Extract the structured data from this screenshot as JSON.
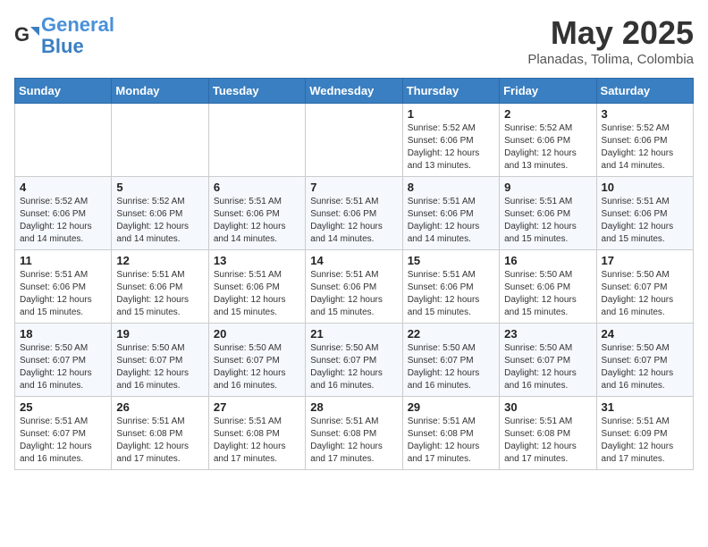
{
  "logo": {
    "line1": "General",
    "line2": "Blue"
  },
  "title": "May 2025",
  "location": "Planadas, Tolima, Colombia",
  "weekdays": [
    "Sunday",
    "Monday",
    "Tuesday",
    "Wednesday",
    "Thursday",
    "Friday",
    "Saturday"
  ],
  "weeks": [
    [
      {
        "day": "",
        "info": ""
      },
      {
        "day": "",
        "info": ""
      },
      {
        "day": "",
        "info": ""
      },
      {
        "day": "",
        "info": ""
      },
      {
        "day": "1",
        "info": "Sunrise: 5:52 AM\nSunset: 6:06 PM\nDaylight: 12 hours\nand 13 minutes."
      },
      {
        "day": "2",
        "info": "Sunrise: 5:52 AM\nSunset: 6:06 PM\nDaylight: 12 hours\nand 13 minutes."
      },
      {
        "day": "3",
        "info": "Sunrise: 5:52 AM\nSunset: 6:06 PM\nDaylight: 12 hours\nand 14 minutes."
      }
    ],
    [
      {
        "day": "4",
        "info": "Sunrise: 5:52 AM\nSunset: 6:06 PM\nDaylight: 12 hours\nand 14 minutes."
      },
      {
        "day": "5",
        "info": "Sunrise: 5:52 AM\nSunset: 6:06 PM\nDaylight: 12 hours\nand 14 minutes."
      },
      {
        "day": "6",
        "info": "Sunrise: 5:51 AM\nSunset: 6:06 PM\nDaylight: 12 hours\nand 14 minutes."
      },
      {
        "day": "7",
        "info": "Sunrise: 5:51 AM\nSunset: 6:06 PM\nDaylight: 12 hours\nand 14 minutes."
      },
      {
        "day": "8",
        "info": "Sunrise: 5:51 AM\nSunset: 6:06 PM\nDaylight: 12 hours\nand 14 minutes."
      },
      {
        "day": "9",
        "info": "Sunrise: 5:51 AM\nSunset: 6:06 PM\nDaylight: 12 hours\nand 15 minutes."
      },
      {
        "day": "10",
        "info": "Sunrise: 5:51 AM\nSunset: 6:06 PM\nDaylight: 12 hours\nand 15 minutes."
      }
    ],
    [
      {
        "day": "11",
        "info": "Sunrise: 5:51 AM\nSunset: 6:06 PM\nDaylight: 12 hours\nand 15 minutes."
      },
      {
        "day": "12",
        "info": "Sunrise: 5:51 AM\nSunset: 6:06 PM\nDaylight: 12 hours\nand 15 minutes."
      },
      {
        "day": "13",
        "info": "Sunrise: 5:51 AM\nSunset: 6:06 PM\nDaylight: 12 hours\nand 15 minutes."
      },
      {
        "day": "14",
        "info": "Sunrise: 5:51 AM\nSunset: 6:06 PM\nDaylight: 12 hours\nand 15 minutes."
      },
      {
        "day": "15",
        "info": "Sunrise: 5:51 AM\nSunset: 6:06 PM\nDaylight: 12 hours\nand 15 minutes."
      },
      {
        "day": "16",
        "info": "Sunrise: 5:50 AM\nSunset: 6:06 PM\nDaylight: 12 hours\nand 15 minutes."
      },
      {
        "day": "17",
        "info": "Sunrise: 5:50 AM\nSunset: 6:07 PM\nDaylight: 12 hours\nand 16 minutes."
      }
    ],
    [
      {
        "day": "18",
        "info": "Sunrise: 5:50 AM\nSunset: 6:07 PM\nDaylight: 12 hours\nand 16 minutes."
      },
      {
        "day": "19",
        "info": "Sunrise: 5:50 AM\nSunset: 6:07 PM\nDaylight: 12 hours\nand 16 minutes."
      },
      {
        "day": "20",
        "info": "Sunrise: 5:50 AM\nSunset: 6:07 PM\nDaylight: 12 hours\nand 16 minutes."
      },
      {
        "day": "21",
        "info": "Sunrise: 5:50 AM\nSunset: 6:07 PM\nDaylight: 12 hours\nand 16 minutes."
      },
      {
        "day": "22",
        "info": "Sunrise: 5:50 AM\nSunset: 6:07 PM\nDaylight: 12 hours\nand 16 minutes."
      },
      {
        "day": "23",
        "info": "Sunrise: 5:50 AM\nSunset: 6:07 PM\nDaylight: 12 hours\nand 16 minutes."
      },
      {
        "day": "24",
        "info": "Sunrise: 5:50 AM\nSunset: 6:07 PM\nDaylight: 12 hours\nand 16 minutes."
      }
    ],
    [
      {
        "day": "25",
        "info": "Sunrise: 5:51 AM\nSunset: 6:07 PM\nDaylight: 12 hours\nand 16 minutes."
      },
      {
        "day": "26",
        "info": "Sunrise: 5:51 AM\nSunset: 6:08 PM\nDaylight: 12 hours\nand 17 minutes."
      },
      {
        "day": "27",
        "info": "Sunrise: 5:51 AM\nSunset: 6:08 PM\nDaylight: 12 hours\nand 17 minutes."
      },
      {
        "day": "28",
        "info": "Sunrise: 5:51 AM\nSunset: 6:08 PM\nDaylight: 12 hours\nand 17 minutes."
      },
      {
        "day": "29",
        "info": "Sunrise: 5:51 AM\nSunset: 6:08 PM\nDaylight: 12 hours\nand 17 minutes."
      },
      {
        "day": "30",
        "info": "Sunrise: 5:51 AM\nSunset: 6:08 PM\nDaylight: 12 hours\nand 17 minutes."
      },
      {
        "day": "31",
        "info": "Sunrise: 5:51 AM\nSunset: 6:09 PM\nDaylight: 12 hours\nand 17 minutes."
      }
    ]
  ]
}
